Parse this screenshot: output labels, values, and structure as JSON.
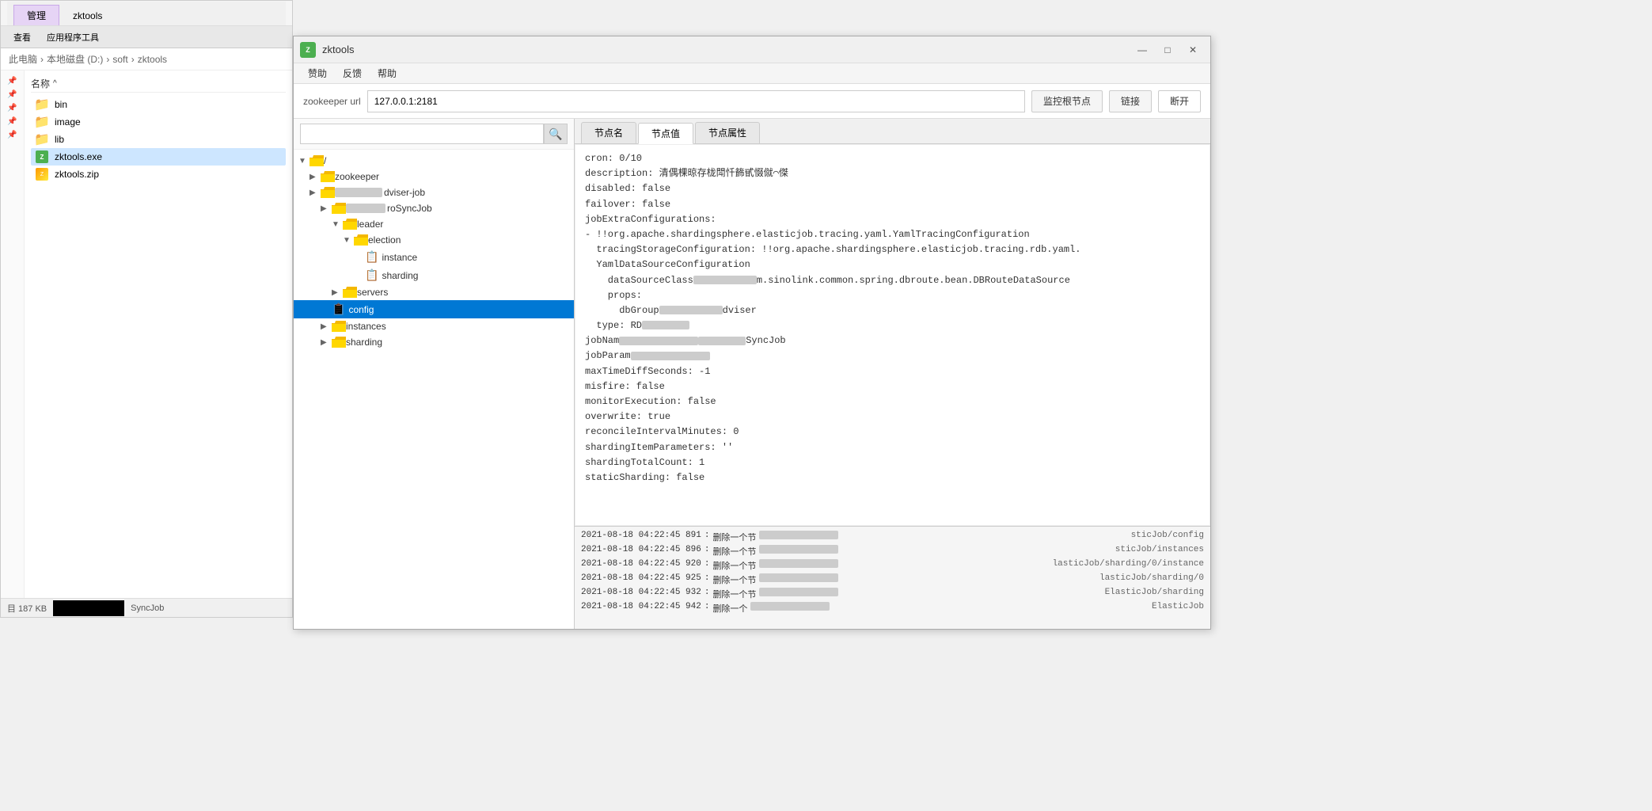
{
  "explorer": {
    "title": "管理",
    "tab2": "zktools",
    "breadcrumb": [
      "此电脑",
      "本地磁盘 (D:)",
      "soft",
      "zktools"
    ],
    "col_name": "名称",
    "col_sort": "^",
    "files": [
      {
        "name": "bin",
        "type": "folder",
        "pinned": true
      },
      {
        "name": "image",
        "type": "folder",
        "pinned": true
      },
      {
        "name": "lib",
        "type": "folder",
        "pinned": true
      },
      {
        "name": "zktools.exe",
        "type": "exe",
        "pinned": true
      },
      {
        "name": "zktools.zip",
        "type": "zip",
        "pinned": true
      }
    ],
    "status_size": "目 187 KB",
    "menu": {
      "view": "查看",
      "tools": "应用程序工具"
    }
  },
  "app": {
    "title": "zktools",
    "menubar": [
      "赞助",
      "反馈",
      "帮助"
    ],
    "toolbar": {
      "zk_label": "zookeeper url",
      "zk_url": "127.0.0.1:2181",
      "btn_monitor": "监控根节点",
      "btn_connect": "链接",
      "btn_disconnect": "断开"
    },
    "tabs": [
      "节点名",
      "节点值",
      "节点属性"
    ],
    "active_tab": 1,
    "tree": {
      "nodes": [
        {
          "id": "root",
          "label": "/",
          "level": 0,
          "expanded": true,
          "type": "folder"
        },
        {
          "id": "zookeeper",
          "label": "zookeeper",
          "level": 1,
          "expanded": false,
          "type": "folder"
        },
        {
          "id": "adviser-job",
          "label": "adviser-job",
          "level": 1,
          "expanded": true,
          "type": "folder",
          "blurred": true
        },
        {
          "id": "proSyncJob",
          "label": "roSyncJob",
          "level": 2,
          "expanded": true,
          "type": "folder",
          "blurred": true
        },
        {
          "id": "leader",
          "label": "leader",
          "level": 3,
          "expanded": true,
          "type": "folder"
        },
        {
          "id": "election",
          "label": "election",
          "level": 4,
          "expanded": true,
          "type": "folder"
        },
        {
          "id": "instance",
          "label": "instance",
          "level": 5,
          "expanded": false,
          "type": "file"
        },
        {
          "id": "sharding_leaf",
          "label": "sharding",
          "level": 4,
          "expanded": false,
          "type": "file"
        },
        {
          "id": "servers",
          "label": "servers",
          "level": 3,
          "expanded": false,
          "type": "folder"
        },
        {
          "id": "config",
          "label": "config",
          "level": 2,
          "expanded": false,
          "type": "file",
          "selected": true
        },
        {
          "id": "instances",
          "label": "instances",
          "level": 2,
          "expanded": false,
          "type": "folder"
        },
        {
          "id": "sharding",
          "label": "sharding",
          "level": 2,
          "expanded": false,
          "type": "folder"
        }
      ]
    },
    "content": {
      "lines": [
        "cron: 0/10",
        "description: 清偶棵晾存栊閗忏籂甙惙僦⌒傑",
        "disabled: false",
        "failover: false",
        "jobExtraConfigurations:",
        "- !!org.apache.shardingsphere.elasticjob.tracing.yaml.YamlTracingConfiguration",
        "  tracingStorageConfiguration: !!org.apache.shardingsphere.elasticjob.tracing.rdb.yaml.",
        "  YamlDataSourceConfiguration",
        "    dataSourceClassName: com.sinolink.common.spring.dbroute.bean.DBRouteDataSource",
        "    props:",
        "      dbGroupName: [BLURRED_adviser]",
        "  type: RD[BLURRED]",
        "jobName: [BLURRED_SyncJob]",
        "jobParams: [BLURRED]",
        "maxTimeDiffSeconds: -1",
        "misfire: false",
        "monitorExecution: false",
        "overwrite: true",
        "reconcileIntervalMinutes: 0",
        "shardingItemParameters: ''",
        "shardingTotalCount: 1",
        "staticSharding: false"
      ]
    },
    "logs": [
      {
        "time": "2021-08-18 04:22:45 891",
        "action": "删除一个节",
        "path": "sticJob/config"
      },
      {
        "time": "2021-08-18 04:22:45 896",
        "action": "删除一个节",
        "path": "sticJob/instances"
      },
      {
        "time": "2021-08-18 04:22:45 920",
        "action": "删除一个节",
        "path": "lasticJob/sharding/0/instance"
      },
      {
        "time": "2021-08-18 04:22:45 925",
        "action": "删除一个节",
        "path": "lasticJob/sharding/0"
      },
      {
        "time": "2021-08-18 04:22:45 932",
        "action": "删除一个节",
        "path": "ElasticJob/sharding"
      },
      {
        "time": "2021-08-18 04:22:45 942",
        "action": "删除一个",
        "path": "ElasticJob"
      }
    ]
  },
  "icons": {
    "search": "🔍",
    "folder": "📁",
    "file": "📄",
    "pin": "📌",
    "minimize": "—",
    "maximize": "□",
    "close": "✕",
    "triangle_right": "▶",
    "triangle_down": "▼",
    "chevron_right": "›"
  }
}
